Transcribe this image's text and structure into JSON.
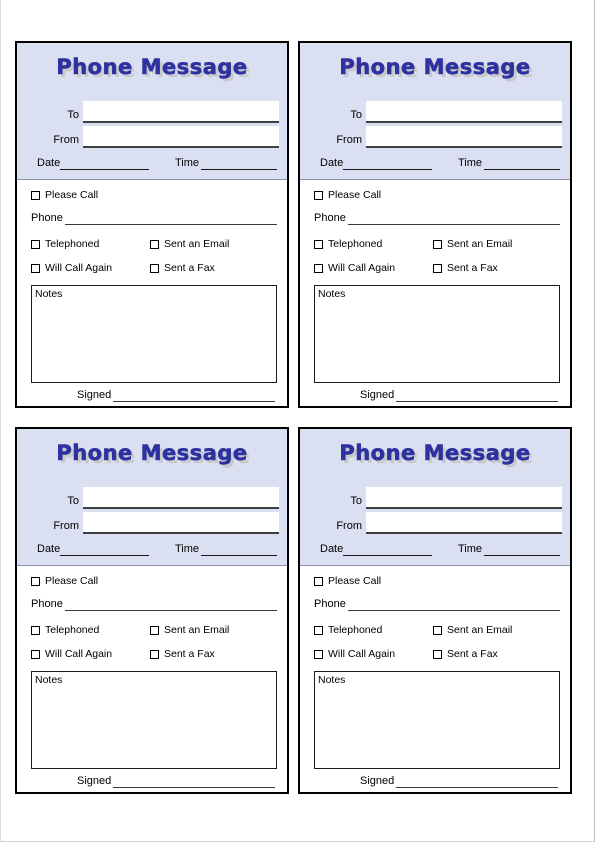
{
  "document": {
    "title": "Phone Message",
    "page_background": "#ffffff",
    "card_header_color": "#dbdff2",
    "title_color": "#2e32a0",
    "title_shadow_color": "#c9c9c9",
    "border_color": "#000000"
  },
  "card": {
    "title": "Phone Message",
    "to_label": "To",
    "from_label": "From",
    "date_label": "Date",
    "time_label": "Time",
    "to_value": "",
    "from_value": "",
    "date_value": "",
    "time_value": "",
    "please_call_label": "Please Call",
    "phone_label": "Phone",
    "phone_value": "",
    "telephoned_label": "Telephoned",
    "sent_an_email_label": "Sent an Email",
    "will_call_again_label": "Will Call Again",
    "sent_a_fax_label": "Sent a Fax",
    "notes_label": "Notes",
    "notes_value": "",
    "signed_label": "Signed",
    "signed_value": ""
  },
  "cards": [
    {
      "position": "top-left"
    },
    {
      "position": "top-right"
    },
    {
      "position": "bottom-left"
    },
    {
      "position": "bottom-right"
    }
  ]
}
